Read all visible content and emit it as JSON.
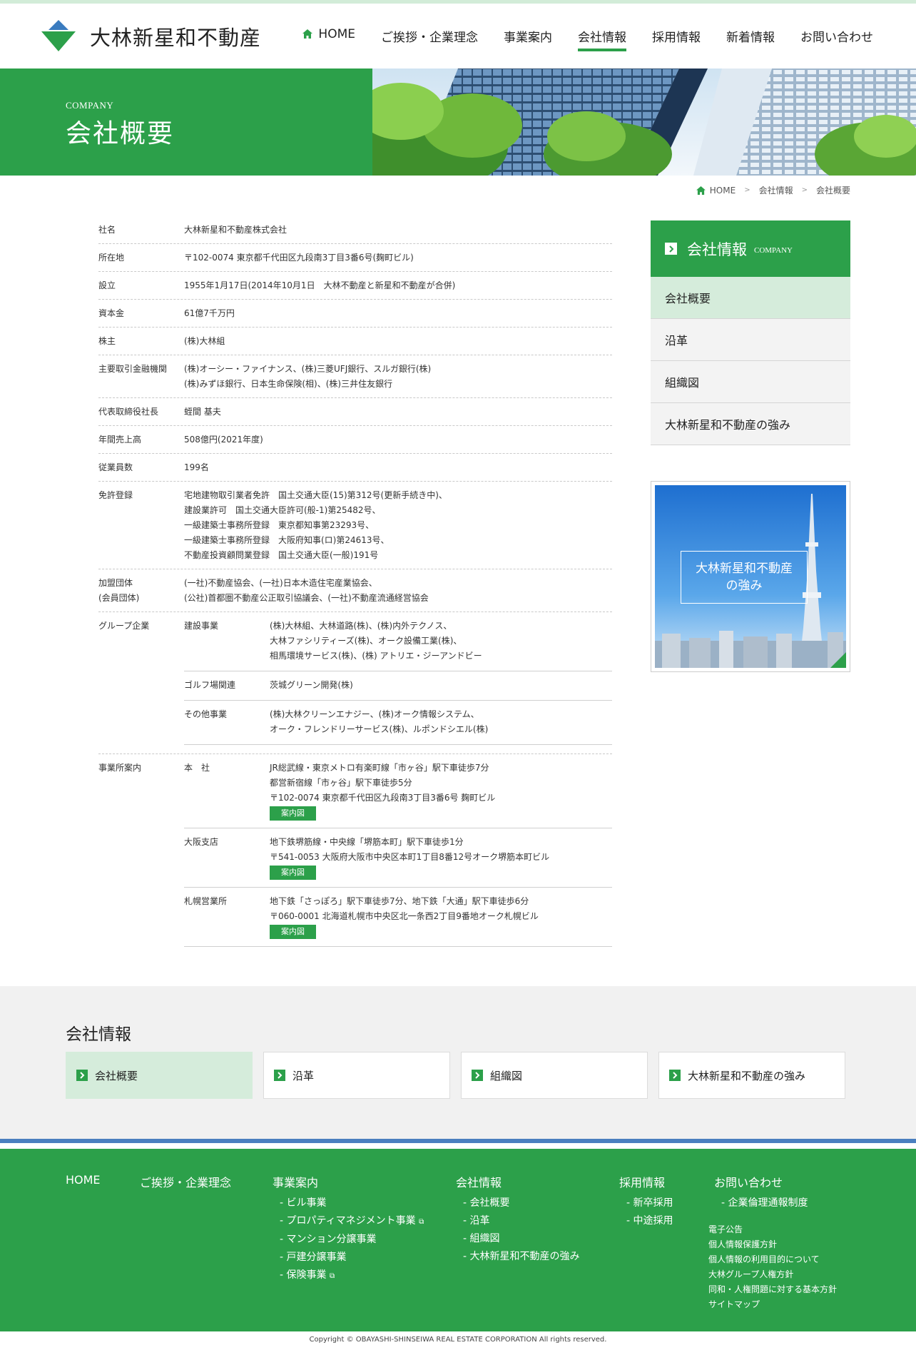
{
  "header": {
    "logo_text": "大林新星和不動産",
    "nav": [
      {
        "label": "HOME"
      },
      {
        "label": "ご挨拶・企業理念"
      },
      {
        "label": "事業案内"
      },
      {
        "label": "会社情報"
      },
      {
        "label": "採用情報"
      },
      {
        "label": "新着情報"
      },
      {
        "label": "お問い合わせ"
      }
    ]
  },
  "hero": {
    "sub": "COMPANY",
    "title": "会社概要"
  },
  "breadcrumb": [
    "HOME",
    "会社情報",
    "会社概要"
  ],
  "profile": {
    "rows": [
      {
        "th": "社名",
        "td": [
          "大林新星和不動産株式会社"
        ]
      },
      {
        "th": "所在地",
        "td": [
          "〒102-0074 東京都千代田区九段南3丁目3番6号(麹町ビル)"
        ]
      },
      {
        "th": "設立",
        "td": [
          "1955年1月17日(2014年10月1日　大林不動産と新星和不動産が合併)"
        ]
      },
      {
        "th": "資本金",
        "td": [
          "61億7千万円"
        ]
      },
      {
        "th": "株主",
        "td": [
          "(株)大林組"
        ]
      },
      {
        "th": "主要取引金融機関",
        "td": [
          "(株)オーシー・ファイナンス、(株)三菱UFJ銀行、スルガ銀行(株)",
          "(株)みずほ銀行、日本生命保険(相)、(株)三井住友銀行"
        ]
      },
      {
        "th": "代表取締役社長",
        "td": [
          "蛭間 基夫"
        ]
      },
      {
        "th": "年間売上高",
        "td": [
          "508億円(2021年度)"
        ]
      },
      {
        "th": "従業員数",
        "td": [
          "199名"
        ]
      },
      {
        "th": "免許登録",
        "td": [
          "宅地建物取引業者免許　国土交通大臣(15)第312号(更新手続き中)、",
          "建設業許可　国土交通大臣許可(般-1)第25482号、",
          "一級建築士事務所登録　東京都知事第23293号、",
          "一級建築士事務所登録　大阪府知事(ロ)第24613号、",
          "不動産投資顧問業登録　国土交通大臣(一般)191号"
        ]
      },
      {
        "th": "加盟団体",
        "th2": "(会員団体)",
        "td": [
          "(一社)不動産協会、(一社)日本木造住宅産業協会、",
          "(公社)首都圏不動産公正取引協議会、(一社)不動産流通経営協会"
        ]
      }
    ],
    "group": {
      "th": "グループ企業",
      "items": [
        {
          "name": "建設事業",
          "lines": [
            "(株)大林組、大林道路(株)、(株)内外テクノス、",
            "大林ファシリティーズ(株)、オーク設備工業(株)、",
            "相馬環境サービス(株)、(株) アトリエ・ジーアンドビー"
          ]
        },
        {
          "name": "ゴルフ場関連",
          "lines": [
            "茨城グリーン開発(株)"
          ]
        },
        {
          "name": "その他事業",
          "lines": [
            "(株)大林クリーンエナジー、(株)オーク情報システム、",
            "オーク・フレンドリーサービス(株)、ルポンドシエル(株)"
          ]
        }
      ]
    },
    "offices": {
      "th": "事業所案内",
      "map_label": "案内図",
      "items": [
        {
          "name": "本　社",
          "lines": [
            "JR総武線・東京メトロ有楽町線「市ヶ谷」駅下車徒歩7分",
            "都営新宿線「市ヶ谷」駅下車徒歩5分",
            "〒102-0074 東京都千代田区九段南3丁目3番6号 麹町ビル"
          ]
        },
        {
          "name": "大阪支店",
          "lines": [
            "地下鉄堺筋線・中央線「堺筋本町」駅下車徒歩1分",
            "〒541-0053 大阪府大阪市中央区本町1丁目8番12号オーク堺筋本町ビル"
          ]
        },
        {
          "name": "札幌営業所",
          "lines": [
            "地下鉄「さっぽろ」駅下車徒歩7分、地下鉄「大通」駅下車徒歩6分",
            "〒060-0001 北海道札幌市中央区北一条西2丁目9番地オーク札幌ビル"
          ]
        }
      ]
    }
  },
  "sidebar": {
    "title": "会社情報",
    "title_en": "COMPANY",
    "items": [
      "会社概要",
      "沿革",
      "組織図",
      "大林新星和不動産の強み"
    ],
    "banner_text": [
      "大林新星和不動産",
      "の強み"
    ]
  },
  "bottom": {
    "title": "会社情報",
    "cards": [
      "会社概要",
      "沿革",
      "組織図",
      "大林新星和不動産の強み"
    ]
  },
  "footer": {
    "home": "HOME",
    "greeting": "ご挨拶・企業理念",
    "business": {
      "title": "事業案内",
      "links": [
        "- ビル事業",
        "- プロパティマネジメント事業",
        "- マンション分譲事業",
        "- 戸建分譲事業",
        "- 保険事業"
      ]
    },
    "company": {
      "title": "会社情報",
      "links": [
        "- 会社概要",
        "- 沿革",
        "- 組織図",
        "- 大林新星和不動産の強み"
      ]
    },
    "recruit": {
      "title": "採用情報",
      "links": [
        "- 新卒採用",
        "- 中途採用"
      ]
    },
    "contact": {
      "title": "お問い合わせ",
      "links": [
        "- 企業倫理通報制度"
      ]
    },
    "misc": [
      "電子公告",
      "個人情報保護方針",
      "個人情報の利用目的について",
      "大林グループ人権方針",
      "同和・人権問題に対する基本方針",
      "サイトマップ"
    ]
  },
  "copyright": "Copyright © OBAYASHI-SHINSEIWA REAL ESTATE CORPORATION All rights reserved.",
  "colors": {
    "brand_green": "#2ca04a",
    "light_green": "#d5ecdb",
    "footer_blue_line": "#4a7fbf"
  }
}
